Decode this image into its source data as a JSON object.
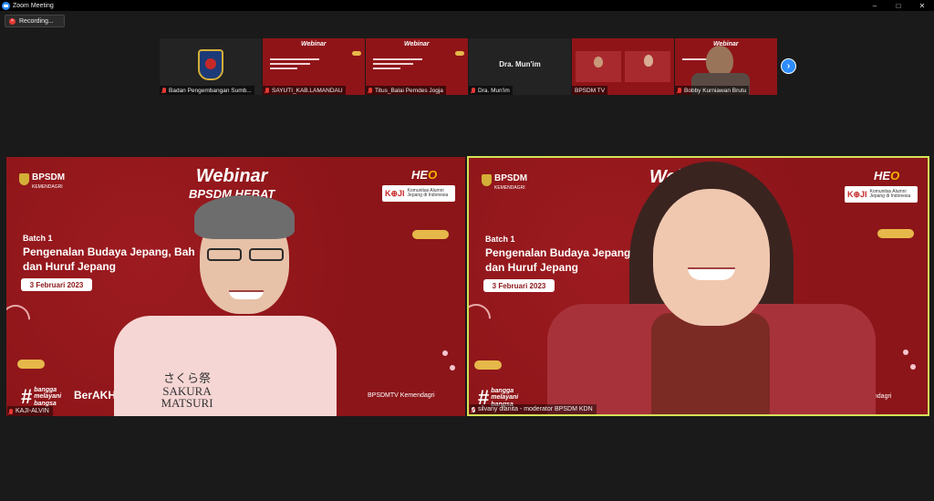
{
  "window": {
    "title": "Zoom Meeting",
    "controls": [
      "–",
      "□",
      "✕"
    ]
  },
  "recording": {
    "label": "Recording..."
  },
  "thumbnails": [
    {
      "name": "Badan Pengembangan Sumb..."
    },
    {
      "name": "SAYUTI_KAB.LAMANDAU",
      "slide_title": "Webinar"
    },
    {
      "name": "Titus_Balai Pemdes Jogja",
      "slide_title": "Webinar"
    },
    {
      "name": "Dra. Mun'im",
      "display_text": "Dra. Mun'im"
    },
    {
      "name": "BPSDM TV"
    },
    {
      "name": "Bobby Kurniawan Brutu",
      "slide_title": "Webinar"
    }
  ],
  "next_page_icon": "chevron-right-icon",
  "slide": {
    "org": "BPSDM",
    "org_sub": "KEMENDAGRI",
    "heo_prefix": "HE",
    "heo_suffix": "O",
    "kaji_letters": "K⊕JI",
    "kaji_text": "Komunitas Alumni Jepang di Indonesia",
    "title": "Webinar",
    "subtitle": "BPSDM HEBAT",
    "batch": "Batch  1",
    "course_left_1": "Pengenalan Budaya Jepang, Bah",
    "course_right_1": "Pengenalan Budaya Jepang",
    "course_2": "dan Huruf Jepang",
    "date": "3 Februari 2023",
    "tagline_hash": "#",
    "tagline": "bangga\nmelayani\nbangsa",
    "berakhlak": "BerAKHLA",
    "channel_left": "BPSDMTV Kemendagri",
    "channel_right": "endagri"
  },
  "speakers": {
    "left": {
      "name": "KAJI-ALVIN",
      "shirt_text": "さくら祭\nSAKURA\nMATSURI"
    },
    "right": {
      "name": "silvany dianita - moderator BPSDM KDN"
    }
  },
  "colors": {
    "slide_red": "#8c1519",
    "active_border": "#d4e157",
    "accent_gold": "#e6b84a",
    "zoom_blue": "#2d8cff"
  }
}
